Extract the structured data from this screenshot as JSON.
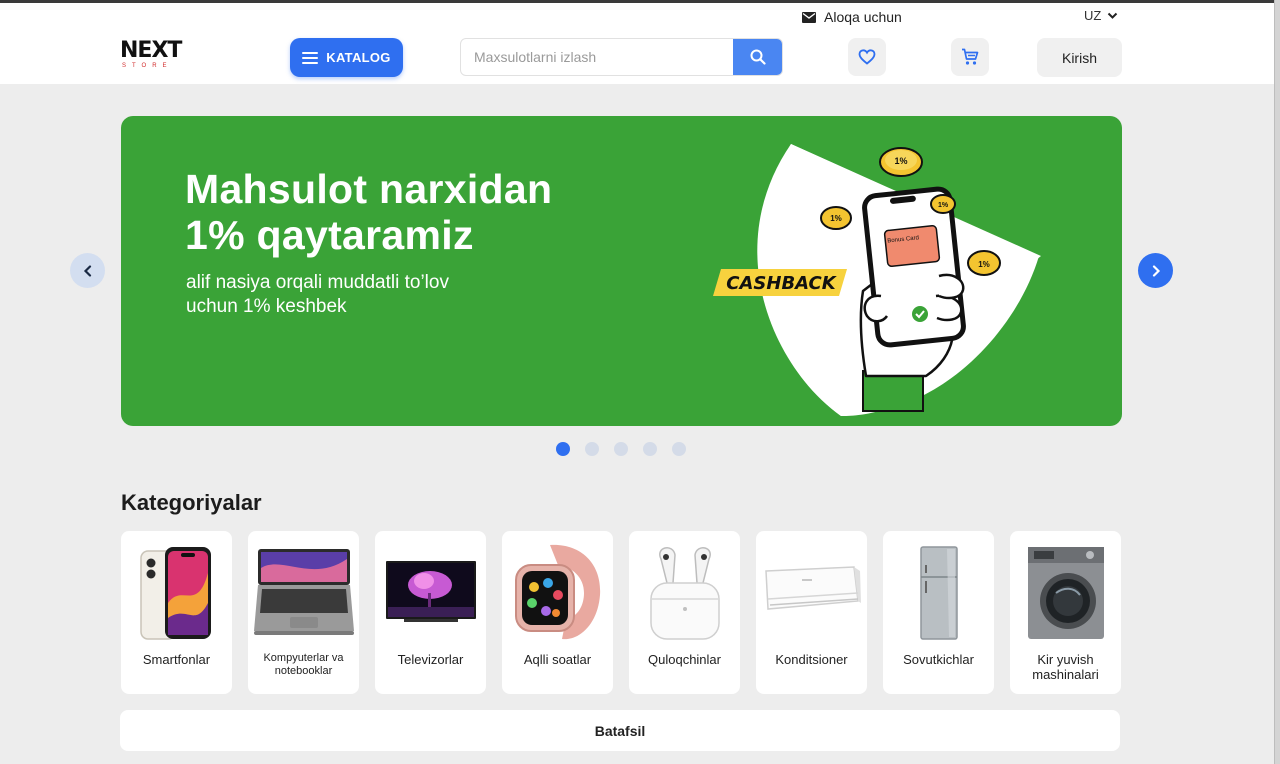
{
  "header": {
    "contact_label": "Aloqa uchun",
    "lang_label": "UZ",
    "logo_word": "NEXT",
    "logo_sub": "STORE",
    "catalog_label": "KATALOG",
    "search_placeholder": "Maxsulotlarni izlash",
    "login_label": "Kirish"
  },
  "banner": {
    "title_line1": "Mahsulot narxidan",
    "title_line2": "1% qaytaramiz",
    "subtitle_line1": "alif nasiya orqali muddatli to’lov",
    "subtitle_line2": "uchun 1% keshbek",
    "tag": "CASHBACK",
    "coin_label": "1%",
    "card_label": "Bonus Card",
    "active_slide": 1,
    "slide_count": 5
  },
  "categories": {
    "title": "Kategoriyalar",
    "items": [
      {
        "label": "Smartfonlar",
        "icon": "smartphone-icon"
      },
      {
        "label": "Kompyuterlar va notebooklar",
        "icon": "laptop-icon"
      },
      {
        "label": "Televizorlar",
        "icon": "tv-icon"
      },
      {
        "label": "Aqlli soatlar",
        "icon": "smartwatch-icon"
      },
      {
        "label": "Quloqchinlar",
        "icon": "earbuds-icon"
      },
      {
        "label": "Konditsioner",
        "icon": "air-conditioner-icon"
      },
      {
        "label": "Sovutkichlar",
        "icon": "fridge-icon"
      },
      {
        "label": "Kir yuvish mashinalari",
        "icon": "washing-machine-icon"
      }
    ],
    "more_label": "Batafsil"
  },
  "colors": {
    "accent": "#2f6ff0",
    "banner_green": "#3aa337",
    "tag_yellow": "#f7d23e",
    "page_bg": "#ededed"
  }
}
